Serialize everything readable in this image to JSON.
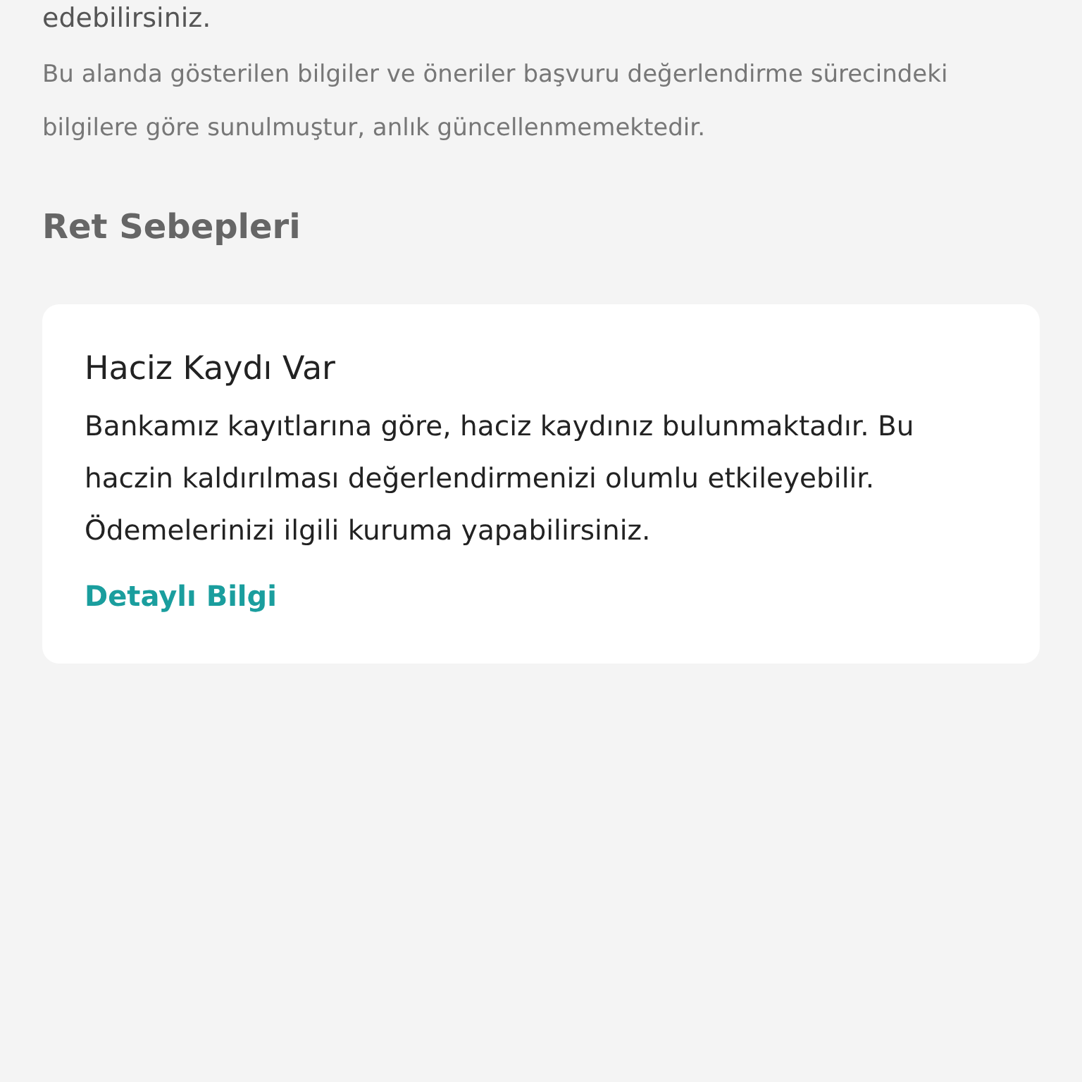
{
  "intro_tail": "edebilirsiniz.",
  "note": "Bu alanda gösterilen bilgiler ve öneriler başvuru değerlendirme sürecindeki bilgilere göre sunulmuştur, anlık güncellenmemektedir.",
  "section_title": "Ret Sebepleri",
  "reasons": [
    {
      "title": "Haciz Kaydı Var",
      "body": "Bankamız kayıtlarına göre, haciz kaydınız bulunmaktadır. Bu haczin kaldırılması değerlendirmenizi olumlu etkileyebilir. Ödemelerinizi ilgili kuruma yapabilirsiniz.",
      "link": "Detaylı Bilgi"
    }
  ]
}
